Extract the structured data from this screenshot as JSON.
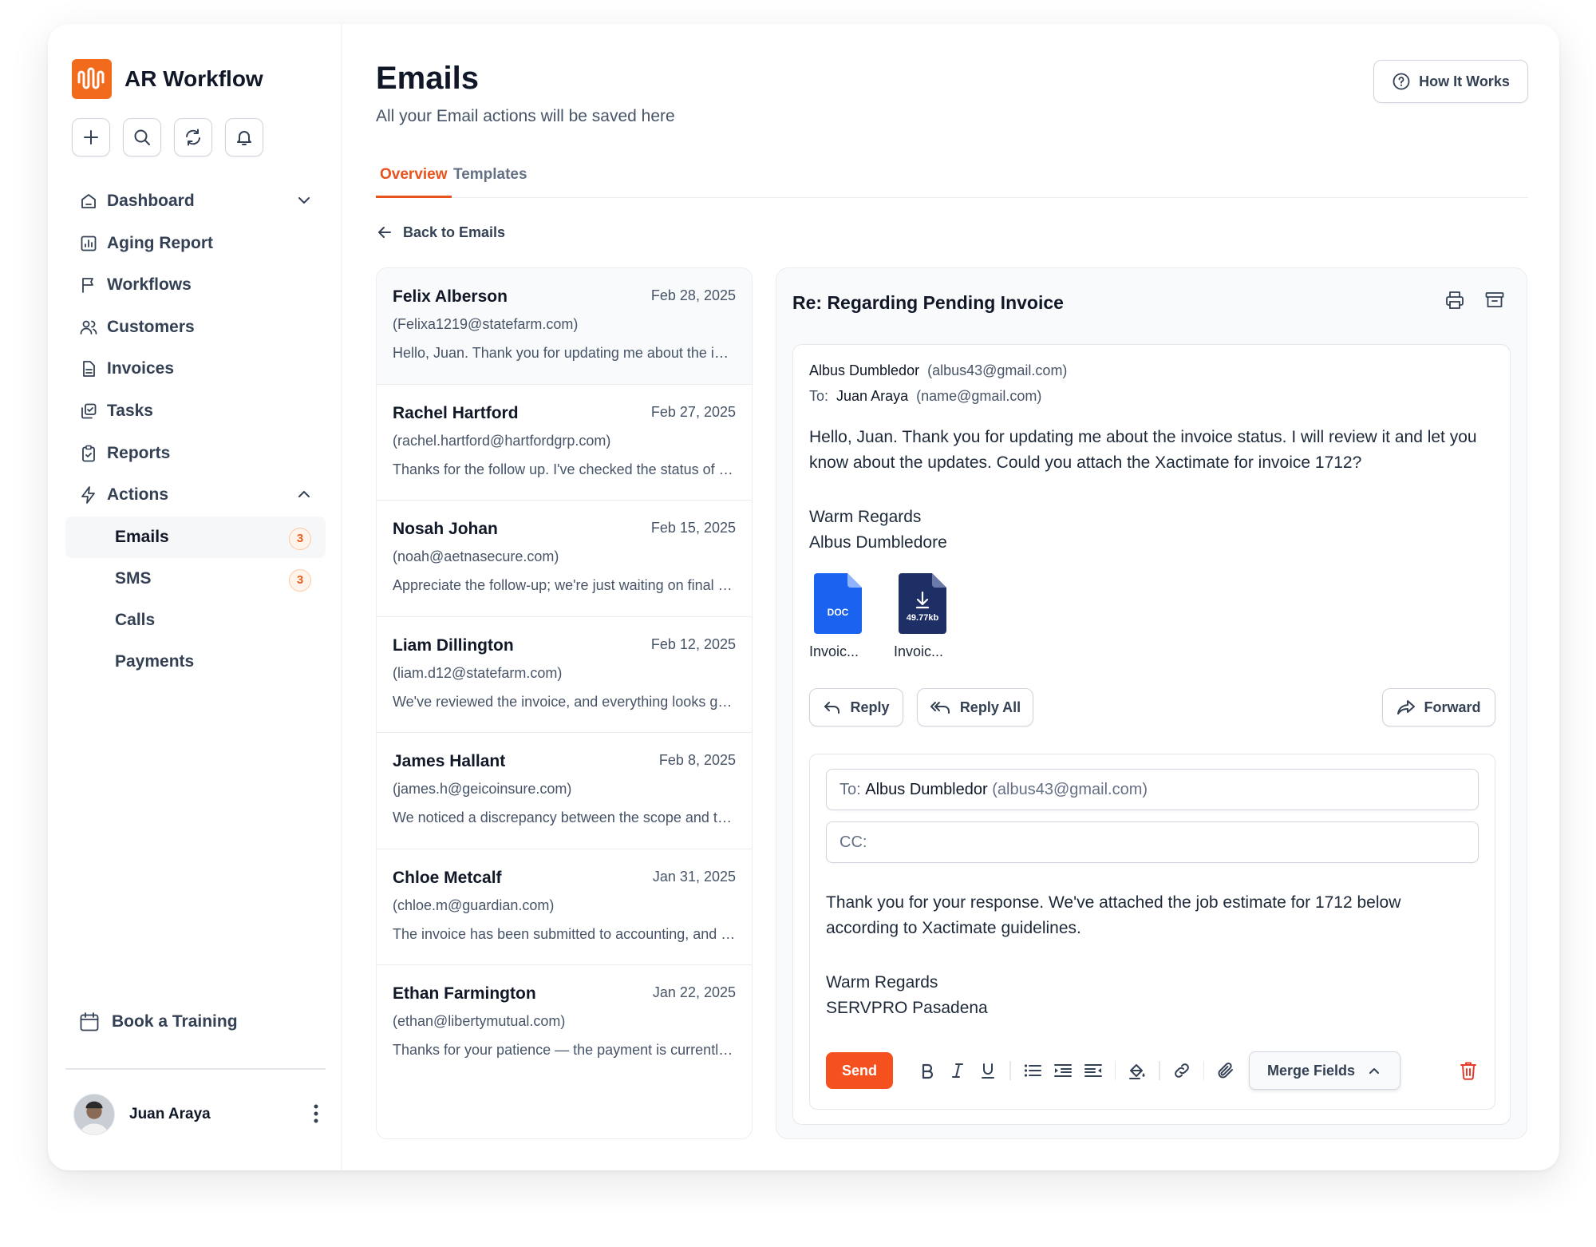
{
  "brand": {
    "name": "AR Workflow",
    "accent": "#f26a1b"
  },
  "quick_actions": [
    {
      "name": "add-icon"
    },
    {
      "name": "search-icon"
    },
    {
      "name": "refresh-icon"
    },
    {
      "name": "bell-icon"
    }
  ],
  "nav": {
    "dashboard": "Dashboard",
    "aging_report": "Aging Report",
    "workflows": "Workflows",
    "customers": "Customers",
    "invoices": "Invoices",
    "tasks": "Tasks",
    "reports": "Reports",
    "actions": "Actions",
    "actions_children": {
      "emails": {
        "label": "Emails",
        "badge": "3"
      },
      "sms": {
        "label": "SMS",
        "badge": "3"
      },
      "calls": {
        "label": "Calls"
      },
      "payments": {
        "label": "Payments"
      }
    },
    "book_training": "Book a Training"
  },
  "user": {
    "name": "Juan Araya"
  },
  "page": {
    "title": "Emails",
    "subtitle": "All your Email actions will be saved here",
    "how_it_works": "How It Works",
    "tabs": [
      "Overview",
      "Templates"
    ],
    "back_label": "Back to Emails"
  },
  "emails": [
    {
      "name": "Felix Alberson",
      "date": "Feb 28, 2025",
      "address": "(Felixa1219@statefarm.com)",
      "preview": "Hello, Juan. Thank you for updating me about the invoice status."
    },
    {
      "name": "Rachel Hartford",
      "date": "Feb 27, 2025",
      "address": "(rachel.hartford@hartfordgrp.com)",
      "preview": "Thanks for the follow up. I've checked the status of the claim."
    },
    {
      "name": "Nosah Johan",
      "date": "Feb 15, 2025",
      "address": "(noah@aetnasecure.com)",
      "preview": "Appreciate the follow-up; we're just waiting on final approval."
    },
    {
      "name": "Liam Dillington",
      "date": "Feb 12, 2025",
      "address": "(liam.d12@statefarm.com)",
      "preview": "We've reviewed the invoice, and everything looks good so far."
    },
    {
      "name": "James Hallant",
      "date": "Feb 8, 2025",
      "address": "(james.h@geicoinsure.com)",
      "preview": "We noticed a discrepancy between the scope and the invoice."
    },
    {
      "name": "Chloe Metcalf",
      "date": "Jan 31, 2025",
      "address": "(chloe.m@guardian.com)",
      "preview": "The invoice has been submitted to accounting, and payment is pending."
    },
    {
      "name": "Ethan Farmington",
      "date": "Jan 22, 2025",
      "address": "(ethan@libertymutual.com)",
      "preview": "Thanks for your patience — the payment is currently being processed."
    }
  ],
  "detail": {
    "subject": "Re: Regarding Pending Invoice",
    "from_name": "Albus Dumbledor",
    "from_email": "(albus43@gmail.com)",
    "to_label": "To:",
    "to_name": "Juan Araya",
    "to_email": "(name@gmail.com)",
    "body": "Hello, Juan. Thank you for updating me about the invoice status. I will review it and let you know about the updates. Could you attach the Xactimate for invoice 1712?",
    "sig_line1": "Warm Regards",
    "sig_line2": "Albus Dumbledore",
    "attachments": [
      {
        "type_label": "DOC",
        "name": "Invoic..."
      },
      {
        "size_label": "49.77kb",
        "name": "Invoic..."
      }
    ],
    "reply": "Reply",
    "reply_all": "Reply All",
    "forward": "Forward"
  },
  "compose": {
    "to_label": "To:",
    "to_name": "Albus Dumbledor",
    "to_email": "(albus43@gmail.com)",
    "cc_label": "CC:",
    "body": "Thank you for your response. We've attached the job estimate for 1712 below according to Xactimate guidelines.",
    "sig_line1": "Warm Regards",
    "sig_line2": "SERVPRO Pasadena",
    "send": "Send",
    "merge_fields": "Merge Fields"
  },
  "colors": {
    "accent_orange": "#e8531d",
    "send_button": "#f4511e",
    "doc_blue": "#1a63f0",
    "doc_navy": "#1e2f66",
    "delete_red": "#e53b2c"
  }
}
